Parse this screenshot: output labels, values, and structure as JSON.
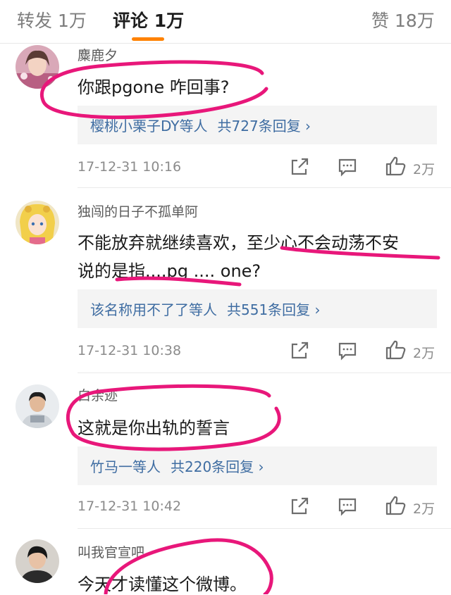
{
  "tabs": {
    "repost": "转发 1万",
    "comments": "评论 1万",
    "likes": "赞 18万"
  },
  "colors": {
    "accent": "#ff8200",
    "link": "#3f6da2",
    "annotation": "#e8177a"
  },
  "comments": [
    {
      "user": "麋鹿夕",
      "text": "你跟pgone 咋回事?",
      "reply_users": "樱桃小栗子DY等人",
      "reply_count": "共727条回复 ›",
      "time": "17-12-31 10:16",
      "likes": "2万",
      "icons": [
        "share-icon",
        "comment-icon",
        "like-icon"
      ]
    },
    {
      "user": "独闯的日子不孤单阿",
      "text_line1": "不能放弃就继续喜欢，至少心不会动荡不安",
      "text_line2": "说的是指....pg .... one?",
      "reply_users": "该名称用不了了等人",
      "reply_count": "共551条回复 ›",
      "time": "17-12-31 10:38",
      "likes": "2万",
      "icons": [
        "share-icon",
        "comment-icon",
        "like-icon"
      ]
    },
    {
      "user": "白余迹",
      "text": "这就是你出轨的誓言",
      "reply_users": "竹马一等人",
      "reply_count": "共220条回复 ›",
      "time": "17-12-31 10:42",
      "likes": "2万",
      "icons": [
        "share-icon",
        "comment-icon",
        "like-icon"
      ]
    },
    {
      "user": "叫我官宣吧",
      "text": "今天才读懂这个微博。"
    }
  ]
}
